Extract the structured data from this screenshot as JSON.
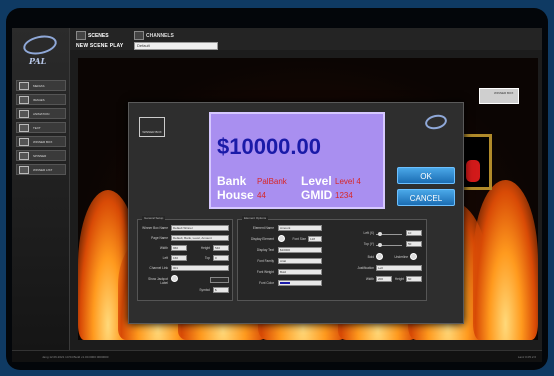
{
  "sidebar": {
    "items": [
      {
        "label": "MEDIAS",
        "icon": "media-icon"
      },
      {
        "label": "IMAGES",
        "icon": "image-icon"
      },
      {
        "label": "ANIMATION",
        "icon": "animation-icon"
      },
      {
        "label": "TEXT",
        "icon": "text-icon"
      },
      {
        "label": "WINNER BOX",
        "icon": "winner-box-icon"
      },
      {
        "label": "SPINNER",
        "icon": "spinner-icon"
      },
      {
        "label": "WINNER LIST",
        "icon": "winner-list-icon"
      }
    ]
  },
  "tabs": [
    {
      "label": "SCENES",
      "icon": "scenes-icon"
    },
    {
      "label": "CHANNELS",
      "icon": "channels-icon"
    }
  ],
  "toolbar": {
    "new_scene_label": "NEW SCENE",
    "play_label": "PLAY",
    "play_value": "Default"
  },
  "stage": {
    "scene_thumb_label": "WINNER BOX"
  },
  "dialog": {
    "icon_label": "WINNER BOX",
    "preview": {
      "amount": "$10000.00",
      "bank_label": "Bank",
      "bank_value": "PalBank",
      "level_label": "Level",
      "level_value": "Level 4",
      "house_label": "House",
      "house_value": "44",
      "gmid_label": "GMID",
      "gmid_value": "1234"
    },
    "ok_label": "OK",
    "cancel_label": "CANCEL",
    "left_panel": {
      "title": "General Setup",
      "winner_box_name_label": "Winner Box Name",
      "winner_box_name_value": "Default Winner",
      "page_name_label": "Page Name",
      "page_name_value": "Default, Bank, Level, Amount",
      "width_label": "Width",
      "width_value": "960",
      "height_label": "Height",
      "height_value": "540",
      "left_label": "Left",
      "left_value": "160",
      "top_label": "Top",
      "top_value": "0",
      "channel_label": "Channel Link",
      "channel_value": "001",
      "show_label": "Show Jackpot Label",
      "symbol_label": "Symbol",
      "symbol_value": "$"
    },
    "right_panel": {
      "title": "Element Options",
      "element_name_label": "Element Name",
      "element_name_value": "Amount",
      "display_label": "Display Element",
      "font_size_label": "Font Size",
      "font_size_value": "128",
      "display_text_label": "Display Text",
      "display_text_value": "$10000",
      "font_family_label": "Font Family",
      "font_family_value": "Arial",
      "font_weight_label": "Font Weight",
      "font_weight_value": "Bold",
      "font_color_label": "Font Color",
      "font_color_hex": "#1a1aa8",
      "left_x_label": "Left (X)",
      "left_x_value": "10",
      "top_y_label": "Top (Y)",
      "top_y_value": "50",
      "bold_label": "Bold",
      "underline_label": "Underline",
      "justification_label": "Justification",
      "justification_value": "Left",
      "width_label": "Width",
      "width_value": "200",
      "height_label": "Height",
      "height_value": "60"
    }
  },
  "statusbar": {
    "left": "Jang 12.06.2021 14:54 Build v1.00.0000 0000000",
    "right": "Lanz 0.05.2.6"
  }
}
